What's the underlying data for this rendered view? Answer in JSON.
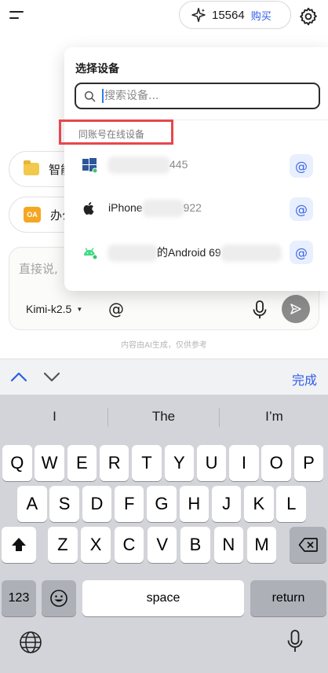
{
  "topbar": {
    "credits": "15564",
    "buy_label": "购买"
  },
  "chips": [
    {
      "label": "智能"
    },
    {
      "label": "办公"
    }
  ],
  "composer": {
    "placeholder": "直接说,",
    "model": "Kimi-k2.5",
    "at_symbol": "@"
  },
  "disclaimer": "内容由AI生成，仅供参考",
  "device_picker": {
    "title": "选择设备",
    "search_placeholder": "搜索设备...",
    "group_label": "同账号在线设备",
    "devices": [
      {
        "name_prefix": "",
        "name_suffix": "445",
        "os": "windows",
        "at": "@"
      },
      {
        "name_prefix": "iPhone",
        "name_suffix": "922",
        "os": "ios",
        "at": "@"
      },
      {
        "name_prefix": "",
        "name_suffix": "的Android 69",
        "os": "android",
        "at": "@"
      }
    ]
  },
  "keyboard_accessory": {
    "done_label": "完成"
  },
  "keyboard": {
    "suggestions": [
      "I",
      "The",
      "I’m"
    ],
    "row1": [
      "Q",
      "W",
      "E",
      "R",
      "T",
      "Y",
      "U",
      "I",
      "O",
      "P"
    ],
    "row2": [
      "A",
      "S",
      "D",
      "F",
      "G",
      "H",
      "J",
      "K",
      "L"
    ],
    "row3": [
      "Z",
      "X",
      "C",
      "V",
      "B",
      "N",
      "M"
    ],
    "numbers_label": "123",
    "space_label": "space",
    "return_label": "return"
  },
  "colors": {
    "accent": "#2f5be8",
    "highlight": "#e5484d",
    "online": "#3ec46d"
  }
}
